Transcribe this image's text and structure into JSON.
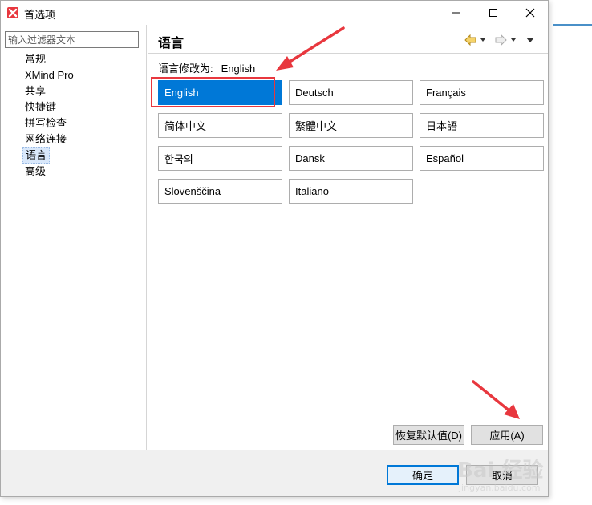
{
  "window": {
    "title": "首选项",
    "icon": "xmind-x-icon",
    "accent_color": "#0078d7",
    "annotation_color": "#e8373e"
  },
  "filter": {
    "placeholder": "输入过滤器文本",
    "value": ""
  },
  "nav": {
    "items": [
      {
        "label": "常规"
      },
      {
        "label": "XMind Pro"
      },
      {
        "label": "共享"
      },
      {
        "label": "快捷键"
      },
      {
        "label": "拼写检查"
      },
      {
        "label": "网络连接"
      },
      {
        "label": "语言",
        "selected": true
      },
      {
        "label": "高级"
      }
    ]
  },
  "page": {
    "title": "语言",
    "changed_label": "语言修改为:",
    "changed_value": "English"
  },
  "languages": [
    {
      "label": "English",
      "active": true
    },
    {
      "label": "Deutsch"
    },
    {
      "label": "Français"
    },
    {
      "label": "简体中文"
    },
    {
      "label": "繁體中文"
    },
    {
      "label": "日本語"
    },
    {
      "label": "한국의"
    },
    {
      "label": "Dansk"
    },
    {
      "label": "Español"
    },
    {
      "label": "Slovenščina"
    },
    {
      "label": "Italiano"
    }
  ],
  "buttons": {
    "restore_defaults": "恢复默认值(D)",
    "apply": "应用(A)",
    "ok": "确定",
    "cancel": "取消"
  },
  "watermark": {
    "text": "Bai 经验",
    "url": "jingyan.baidu.com"
  }
}
